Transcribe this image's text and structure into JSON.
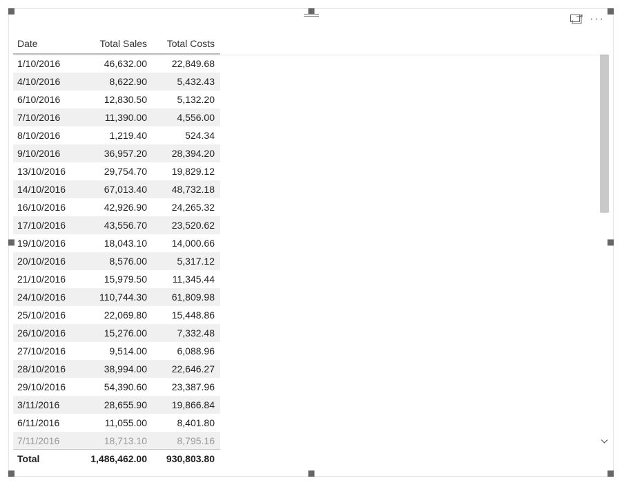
{
  "columns": {
    "date": "Date",
    "total_sales": "Total Sales",
    "total_costs": "Total Costs"
  },
  "rows": [
    {
      "date": "1/10/2016",
      "sales": "46,632.00",
      "costs": "22,849.68"
    },
    {
      "date": "4/10/2016",
      "sales": "8,622.90",
      "costs": "5,432.43"
    },
    {
      "date": "6/10/2016",
      "sales": "12,830.50",
      "costs": "5,132.20"
    },
    {
      "date": "7/10/2016",
      "sales": "11,390.00",
      "costs": "4,556.00"
    },
    {
      "date": "8/10/2016",
      "sales": "1,219.40",
      "costs": "524.34"
    },
    {
      "date": "9/10/2016",
      "sales": "36,957.20",
      "costs": "28,394.20"
    },
    {
      "date": "13/10/2016",
      "sales": "29,754.70",
      "costs": "19,829.12"
    },
    {
      "date": "14/10/2016",
      "sales": "67,013.40",
      "costs": "48,732.18"
    },
    {
      "date": "16/10/2016",
      "sales": "42,926.90",
      "costs": "24,265.32"
    },
    {
      "date": "17/10/2016",
      "sales": "43,556.70",
      "costs": "23,520.62"
    },
    {
      "date": "19/10/2016",
      "sales": "18,043.10",
      "costs": "14,000.66"
    },
    {
      "date": "20/10/2016",
      "sales": "8,576.00",
      "costs": "5,317.12"
    },
    {
      "date": "21/10/2016",
      "sales": "15,979.50",
      "costs": "11,345.44"
    },
    {
      "date": "24/10/2016",
      "sales": "110,744.30",
      "costs": "61,809.98"
    },
    {
      "date": "25/10/2016",
      "sales": "22,069.80",
      "costs": "15,448.86"
    },
    {
      "date": "26/10/2016",
      "sales": "15,276.00",
      "costs": "7,332.48"
    },
    {
      "date": "27/10/2016",
      "sales": "9,514.00",
      "costs": "6,088.96"
    },
    {
      "date": "28/10/2016",
      "sales": "38,994.00",
      "costs": "22,646.27"
    },
    {
      "date": "29/10/2016",
      "sales": "54,390.60",
      "costs": "23,387.96"
    },
    {
      "date": "3/11/2016",
      "sales": "28,655.90",
      "costs": "19,866.84"
    },
    {
      "date": "6/11/2016",
      "sales": "11,055.00",
      "costs": "8,401.80"
    },
    {
      "date": "7/11/2016",
      "sales": "18,713.10",
      "costs": "8,795.16"
    }
  ],
  "totals": {
    "label": "Total",
    "sales": "1,486,462.00",
    "costs": "930,803.80"
  },
  "chart_data": {
    "type": "table",
    "title": "",
    "columns": [
      "Date",
      "Total Sales",
      "Total Costs"
    ],
    "rows": [
      [
        "1/10/2016",
        46632.0,
        22849.68
      ],
      [
        "4/10/2016",
        8622.9,
        5432.43
      ],
      [
        "6/10/2016",
        12830.5,
        5132.2
      ],
      [
        "7/10/2016",
        11390.0,
        4556.0
      ],
      [
        "8/10/2016",
        1219.4,
        524.34
      ],
      [
        "9/10/2016",
        36957.2,
        28394.2
      ],
      [
        "13/10/2016",
        29754.7,
        19829.12
      ],
      [
        "14/10/2016",
        67013.4,
        48732.18
      ],
      [
        "16/10/2016",
        42926.9,
        24265.32
      ],
      [
        "17/10/2016",
        43556.7,
        23520.62
      ],
      [
        "19/10/2016",
        18043.1,
        14000.66
      ],
      [
        "20/10/2016",
        8576.0,
        5317.12
      ],
      [
        "21/10/2016",
        15979.5,
        11345.44
      ],
      [
        "24/10/2016",
        110744.3,
        61809.98
      ],
      [
        "25/10/2016",
        22069.8,
        15448.86
      ],
      [
        "26/10/2016",
        15276.0,
        7332.48
      ],
      [
        "27/10/2016",
        9514.0,
        6088.96
      ],
      [
        "28/10/2016",
        38994.0,
        22646.27
      ],
      [
        "29/10/2016",
        54390.6,
        23387.96
      ],
      [
        "3/11/2016",
        28655.9,
        19866.84
      ],
      [
        "6/11/2016",
        11055.0,
        8401.8
      ],
      [
        "7/11/2016",
        18713.1,
        8795.16
      ]
    ],
    "totals": {
      "Total Sales": 1486462.0,
      "Total Costs": 930803.8
    }
  }
}
